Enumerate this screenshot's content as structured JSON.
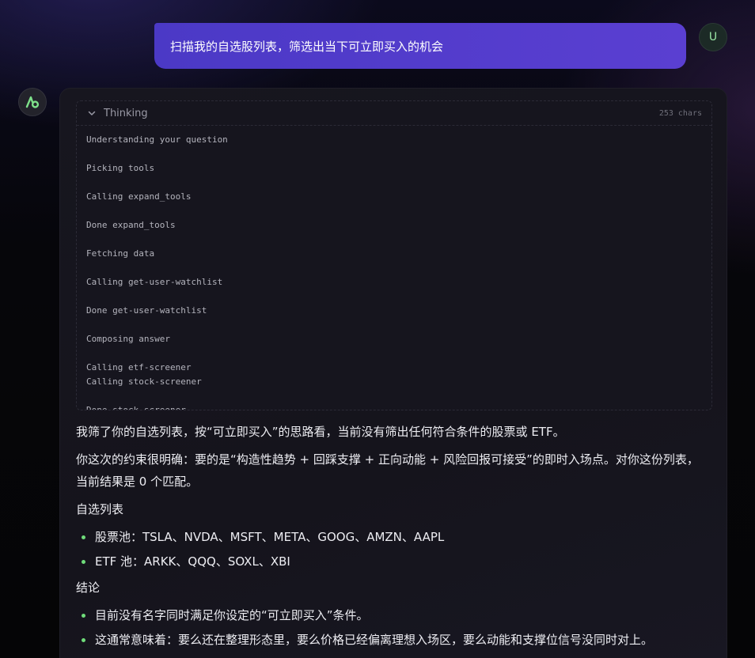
{
  "user_message": {
    "text": "扫描我的自选股列表，筛选出当下可立即买入的机会",
    "avatar_letter": "U"
  },
  "assistant": {
    "avatar_icon": "logo-icon",
    "thinking": {
      "label": "Thinking",
      "count": "253 chars",
      "steps": [
        "Understanding your question",
        "Picking tools",
        "Calling expand_tools",
        "Done expand_tools",
        "Fetching data",
        "Calling get-user-watchlist",
        "Done get-user-watchlist",
        "Composing answer",
        "Calling etf-screener",
        "Calling stock-screener",
        "Done stock-screener"
      ]
    },
    "answer": {
      "p1": "我筛了你的自选列表，按“可立即买入”的思路看，当前没有筛出任何符合条件的股票或 ETF。",
      "p2": "你这次的约束很明确：要的是“构造性趋势 + 回踩支撑 + 正向动能 + 风险回报可接受”的即时入场点。对你这份列表，当前结果是 0 个匹配。",
      "section1_title": "自选列表",
      "section1_items": [
        "股票池：TSLA、NVDA、MSFT、META、GOOG、AMZN、AAPL",
        "ETF 池：ARKK、QQQ、SOXL、XBI"
      ],
      "section2_title": "结论",
      "section2_items": [
        "目前没有名字同时满足你设定的“可立即买入”条件。",
        "这通常意味着：要么还在整理形态里，要么价格已经偏离理想入场区，要么动能和支撑位信号没同时对上。"
      ]
    }
  },
  "colors": {
    "user_bubble": "#4b39c6",
    "bullet": "#6fdc7a",
    "card_bg": "#17161f"
  }
}
